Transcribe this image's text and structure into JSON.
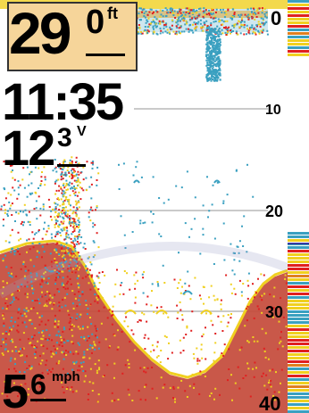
{
  "depth": {
    "whole": "29",
    "decimal": "0",
    "unit": "ft"
  },
  "time": "11:35",
  "voltage": {
    "whole": "12",
    "decimal": "3",
    "unit": "V"
  },
  "speed": {
    "whole": "5",
    "decimal": "6",
    "unit": "mph"
  },
  "depth_scale": [
    "0",
    "10",
    "20",
    "30",
    "40"
  ],
  "colors": {
    "bottom": "#c44a3a",
    "strong_return": "#e02020",
    "mid_return": "#f0d020",
    "weak_return": "#3aa0c0",
    "depth_box": "#f6d59a",
    "grid_line": "#b8b8b8"
  }
}
